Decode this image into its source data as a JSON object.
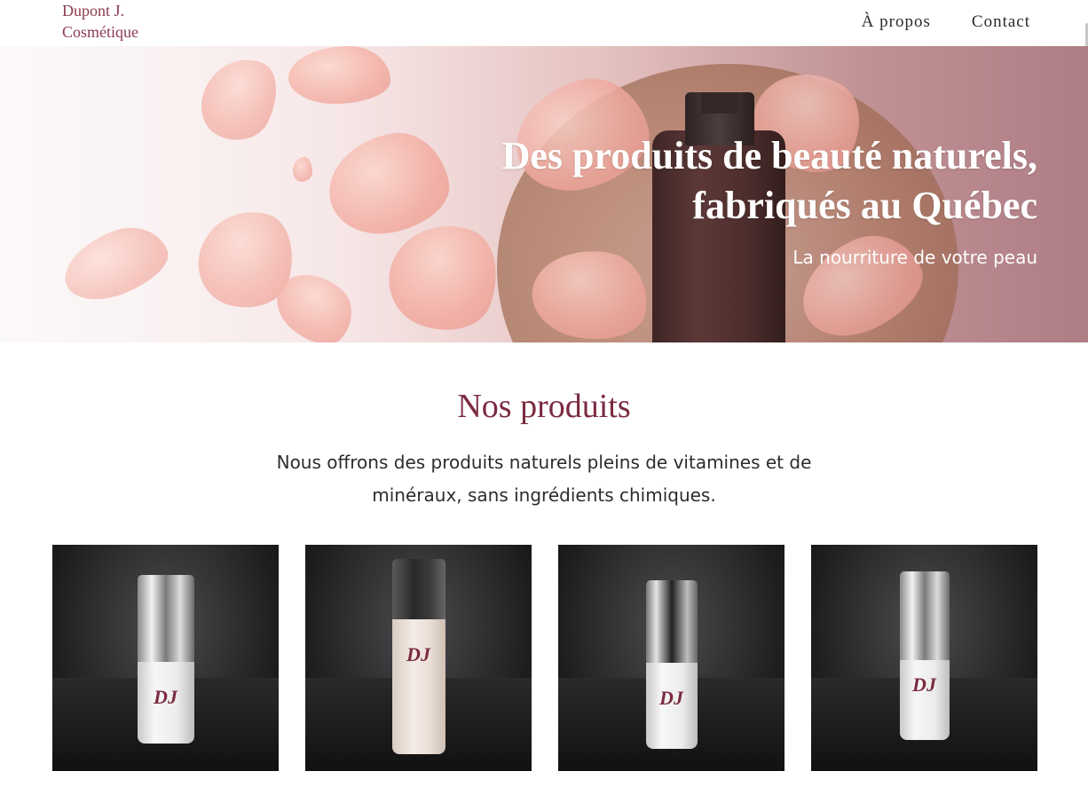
{
  "header": {
    "logo_line1": "Dupont J.",
    "logo_line2": "Cosmétique",
    "nav": [
      {
        "label": "À propos"
      },
      {
        "label": "Contact"
      }
    ]
  },
  "hero": {
    "title_line1": "Des produits de beauté naturels,",
    "title_line2": "fabriqués au Québec",
    "subtitle": "La nourriture de votre peau"
  },
  "products_section": {
    "title": "Nos produits",
    "description": "Nous offrons des produits naturels pleins de vitamines et de minéraux, sans ingrédients chimiques."
  },
  "products": [
    {
      "monogram": "DJ"
    },
    {
      "monogram": "DJ"
    },
    {
      "monogram": "DJ"
    },
    {
      "monogram": "DJ"
    }
  ],
  "colors": {
    "brand": "#7b2b40",
    "logo": "#8a3a4e",
    "nav_text": "#2a2a2a",
    "body_text": "#2c2c2c"
  }
}
